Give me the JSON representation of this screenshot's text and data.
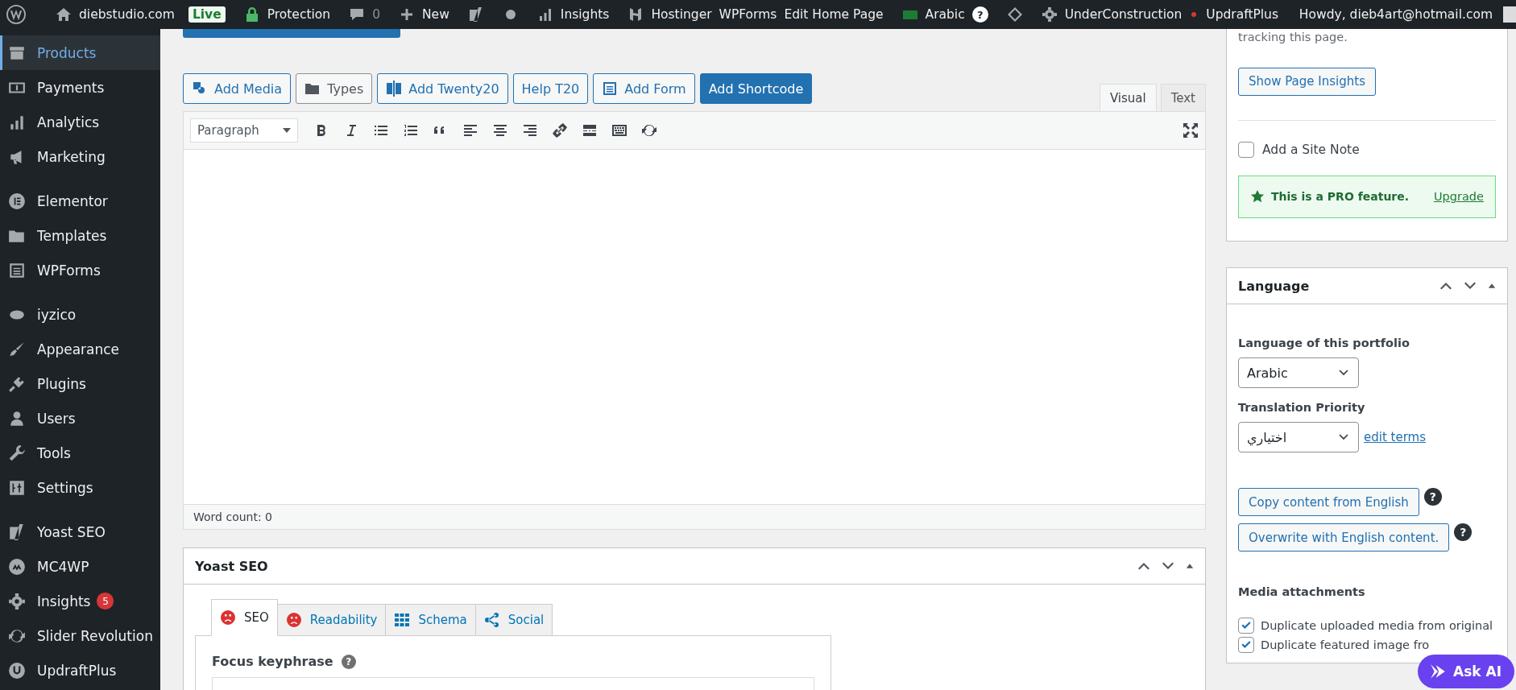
{
  "admin_bar": {
    "items": [
      {
        "label": "diebstudio.com",
        "kind": "text"
      },
      {
        "label": "Live",
        "kind": "badge"
      },
      {
        "label": "Protection",
        "kind": "text"
      },
      {
        "label": "0",
        "kind": "count"
      },
      {
        "label": "New",
        "kind": "text"
      },
      {
        "label": "Insights",
        "kind": "text"
      },
      {
        "label": "Hostinger",
        "kind": "text"
      },
      {
        "label": "WPForms",
        "kind": "text"
      },
      {
        "label": "Edit Home Page",
        "kind": "text"
      },
      {
        "label": "Arabic",
        "kind": "text",
        "help": "?"
      },
      {
        "label": "UnderConstruction",
        "kind": "text"
      },
      {
        "label": "UpdraftPlus",
        "kind": "text"
      }
    ],
    "account": "Howdy, dieb4art@hotmail.com"
  },
  "sidebar": {
    "groups": [
      {
        "items": [
          {
            "label": "Products",
            "selected": true
          },
          {
            "label": "Payments",
            "selected": false
          },
          {
            "label": "Analytics",
            "selected": false
          },
          {
            "label": "Marketing",
            "selected": false
          }
        ]
      },
      {
        "items": [
          {
            "label": "Elementor",
            "selected": false
          },
          {
            "label": "Templates",
            "selected": false
          },
          {
            "label": "WPForms",
            "selected": false
          }
        ]
      },
      {
        "items": [
          {
            "label": "iyzico",
            "selected": false
          },
          {
            "label": "Appearance",
            "selected": false
          },
          {
            "label": "Plugins",
            "selected": false
          },
          {
            "label": "Users",
            "selected": false
          },
          {
            "label": "Tools",
            "selected": false
          },
          {
            "label": "Settings",
            "selected": false
          }
        ]
      },
      {
        "items": [
          {
            "label": "Yoast SEO",
            "selected": false
          },
          {
            "label": "MC4WP",
            "selected": false
          },
          {
            "label": "Insights",
            "selected": false,
            "badge": "5"
          },
          {
            "label": "Slider Revolution",
            "selected": false
          },
          {
            "label": "UpdraftPlus",
            "selected": false
          }
        ]
      }
    ]
  },
  "editor": {
    "media_buttons": [
      {
        "label": "Add Media",
        "kind": "outline"
      },
      {
        "label": "Types",
        "kind": "plain"
      },
      {
        "label": "Add Twenty20",
        "kind": "outline"
      },
      {
        "label": "Help T20",
        "kind": "outline"
      },
      {
        "label": "Add Form",
        "kind": "outline"
      },
      {
        "label": "Add Shortcode",
        "kind": "primary"
      }
    ],
    "tabs": [
      {
        "label": "Visual",
        "selected": true
      },
      {
        "label": "Text",
        "selected": false
      }
    ],
    "format": "Paragraph",
    "word_count": "Word count: 0"
  },
  "yoast": {
    "title": "Yoast SEO",
    "tabs": [
      {
        "label": "SEO",
        "selected": true
      },
      {
        "label": "Readability",
        "selected": false
      },
      {
        "label": "Schema",
        "selected": false
      },
      {
        "label": "Social",
        "selected": false
      }
    ],
    "focus_label": "Focus keyphrase",
    "help": "?"
  },
  "insights_box": {
    "text": "tracking this page.",
    "button": "Show Page Insights",
    "site_note": {
      "label": "Add a Site Note",
      "checked": false
    },
    "pro_text": "This is a PRO feature.",
    "upgrade": "Upgrade"
  },
  "language_box": {
    "title": "Language",
    "language_label": "Language of this portfolio",
    "language": "Arabic",
    "priority_label": "Translation Priority",
    "priority": "اختياري",
    "edit_terms": "edit terms",
    "actions": [
      {
        "label": "Copy content from English",
        "help": "?"
      },
      {
        "label": "Overwrite with English content.",
        "help": "?"
      }
    ],
    "media_label": "Media attachments",
    "media_options": [
      {
        "label": "Duplicate uploaded media from original",
        "checked": true
      },
      {
        "label": "Duplicate featured image fro",
        "checked": true
      }
    ]
  },
  "ask_ai": "Ask AI"
}
